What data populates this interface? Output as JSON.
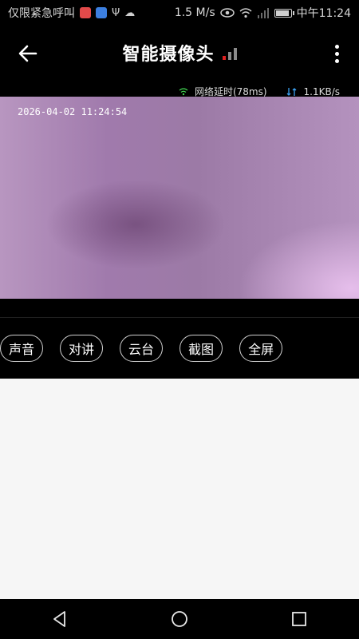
{
  "status_bar": {
    "left_text": "仅限紧急呼叫",
    "app_icons": [
      {
        "name": "red-app-icon",
        "color": "#e24a4a"
      },
      {
        "name": "shield-app-icon",
        "color": "#3c7fe0"
      }
    ],
    "usb_icon": "usb-icon",
    "cloud_icon": "cloud-icon",
    "speed": "1.5 M/s",
    "time": "中午11:24",
    "battery_level": 0.95
  },
  "app_bar": {
    "title": "智能摄像头",
    "signal_bars": [
      {
        "level": 1,
        "color": "#e02020"
      },
      {
        "level": 2,
        "color": "#8a8a8a"
      },
      {
        "level": 3,
        "color": "#8a8a8a"
      }
    ]
  },
  "video": {
    "network_latency": "网络延时(78ms)",
    "bitrate": "1.1KB/s",
    "timestamp": "2026-04-02  11:24:54"
  },
  "controls": [
    {
      "name": "sound-button",
      "label": "声音"
    },
    {
      "name": "talk-button",
      "label": "对讲"
    },
    {
      "name": "ptz-button",
      "label": "云台"
    },
    {
      "name": "screenshot-button",
      "label": "截图"
    },
    {
      "name": "fullscreen-button",
      "label": "全屏"
    }
  ],
  "colors": {
    "accent_green": "#3fd04f",
    "accent_blue": "#3aa0f0"
  }
}
